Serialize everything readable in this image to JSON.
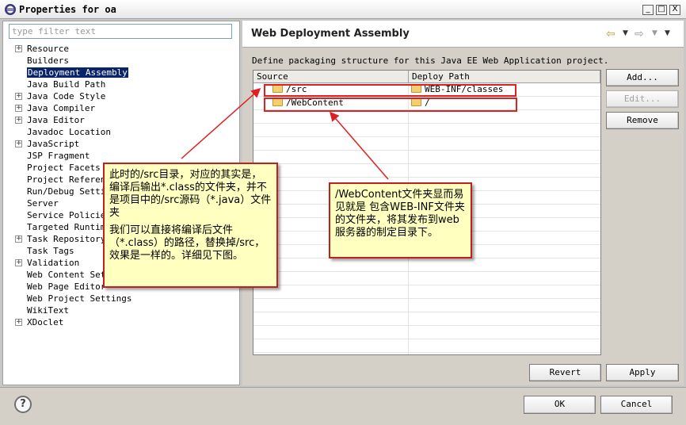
{
  "window": {
    "title": "Properties for oa",
    "minimize": "_",
    "maximize": "□",
    "close": "X"
  },
  "filter": {
    "placeholder": "type filter text"
  },
  "tree": {
    "items": [
      {
        "label": "Resource",
        "expandable": true
      },
      {
        "label": "Builders",
        "expandable": false
      },
      {
        "label": "Deployment Assembly",
        "expandable": false,
        "selected": true
      },
      {
        "label": "Java Build Path",
        "expandable": false
      },
      {
        "label": "Java Code Style",
        "expandable": true
      },
      {
        "label": "Java Compiler",
        "expandable": true
      },
      {
        "label": "Java Editor",
        "expandable": true
      },
      {
        "label": "Javadoc Location",
        "expandable": false
      },
      {
        "label": "JavaScript",
        "expandable": true
      },
      {
        "label": "JSP Fragment",
        "expandable": false
      },
      {
        "label": "Project Facets",
        "expandable": false
      },
      {
        "label": "Project References",
        "expandable": false
      },
      {
        "label": "Run/Debug Settings",
        "expandable": false
      },
      {
        "label": "Server",
        "expandable": false
      },
      {
        "label": "Service Policies",
        "expandable": false
      },
      {
        "label": "Targeted Runtimes",
        "expandable": false
      },
      {
        "label": "Task Repository",
        "expandable": true
      },
      {
        "label": "Task Tags",
        "expandable": false
      },
      {
        "label": "Validation",
        "expandable": true
      },
      {
        "label": "Web Content Settings",
        "expandable": false
      },
      {
        "label": "Web Page Editor",
        "expandable": false
      },
      {
        "label": "Web Project Settings",
        "expandable": false
      },
      {
        "label": "WikiText",
        "expandable": false
      },
      {
        "label": "XDoclet",
        "expandable": true
      }
    ]
  },
  "page": {
    "title": "Web Deployment Assembly",
    "description": "Define packaging structure for this Java EE Web Application project.",
    "nav_back_icon": "arrow-left-icon",
    "nav_forward_icon": "arrow-right-icon",
    "nav_menu_icon": "chevron-down-icon"
  },
  "table": {
    "columns": [
      "Source",
      "Deploy Path"
    ],
    "rows": [
      {
        "source": "/src",
        "deploy_path": "WEB-INF/classes"
      },
      {
        "source": "/WebContent",
        "deploy_path": "/"
      }
    ]
  },
  "buttons": {
    "add": "Add...",
    "edit": "Edit...",
    "remove": "Remove",
    "revert": "Revert",
    "apply": "Apply",
    "ok": "OK",
    "cancel": "Cancel"
  },
  "annotations": {
    "left_p1": "此时的/src目录，对应的其实是，编译后输出*.class的文件夹，并不是项目中的/src源码（*.java）文件夹",
    "left_p2": "我们可以直接将编译后文件（*.class）的路径，替换掉/src，效果是一样的。详细见下图。",
    "right": "/WebContent文件夹显而易见就是 包含WEB-INF文件夹的文件夹，将其发布到web服务器的制定目录下。"
  },
  "colors": {
    "selection": "#0a246a",
    "callout_bg": "#ffffc0",
    "annotation_red": "#e02020"
  }
}
